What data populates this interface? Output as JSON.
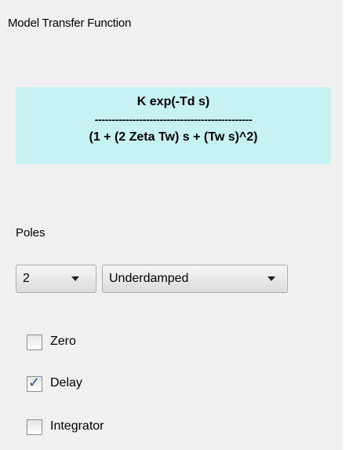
{
  "panel": {
    "title": "Model Transfer Function"
  },
  "formula": {
    "numerator": "K exp(-Td s)",
    "divider": "----------------------------------------------",
    "denominator": "(1 + (2 Zeta Tw) s + (Tw s)^2)"
  },
  "poles": {
    "label": "Poles",
    "count_value": "2",
    "damping_value": "Underdamped"
  },
  "options": [
    {
      "label": "Zero",
      "checked": false
    },
    {
      "label": "Delay",
      "checked": true
    },
    {
      "label": "Integrator",
      "checked": false
    }
  ],
  "icons": {
    "dropdown": "chevron-down-icon",
    "checkmark": "checkmark-icon"
  },
  "colors": {
    "panel_background": "#f0f0f0",
    "formula_background": "#c6f2f2",
    "checkmark": "#2a4f8f"
  }
}
